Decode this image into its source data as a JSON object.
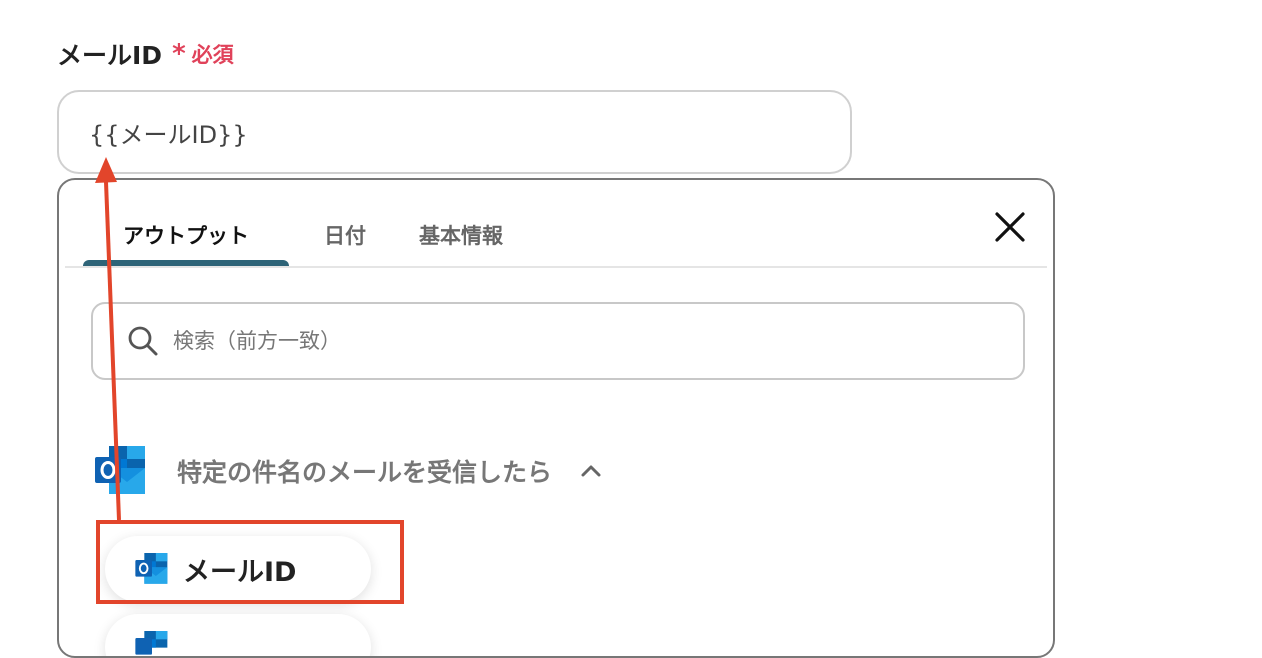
{
  "field": {
    "label": "メールID",
    "required_star": "*",
    "required_text": "必須",
    "value": "{{メールID}}"
  },
  "popover": {
    "tabs": [
      {
        "label": "アウトプット",
        "active": true
      },
      {
        "label": "日付",
        "active": false
      },
      {
        "label": "基本情報",
        "active": false
      }
    ],
    "close_icon": "close-icon",
    "search": {
      "placeholder": "検索（前方一致）",
      "icon": "search-icon"
    },
    "section": {
      "title": "特定の件名のメールを受信したら",
      "icon": "outlook-icon",
      "toggle_icon": "chevron-up-icon"
    },
    "items": [
      {
        "label": "メールID",
        "icon": "outlook-icon"
      }
    ]
  },
  "annotation": {
    "color": "#e2452b"
  },
  "colors": {
    "required": "#e0425a",
    "active_tab_indicator": "#2e6478",
    "annotation": "#e2452b"
  }
}
